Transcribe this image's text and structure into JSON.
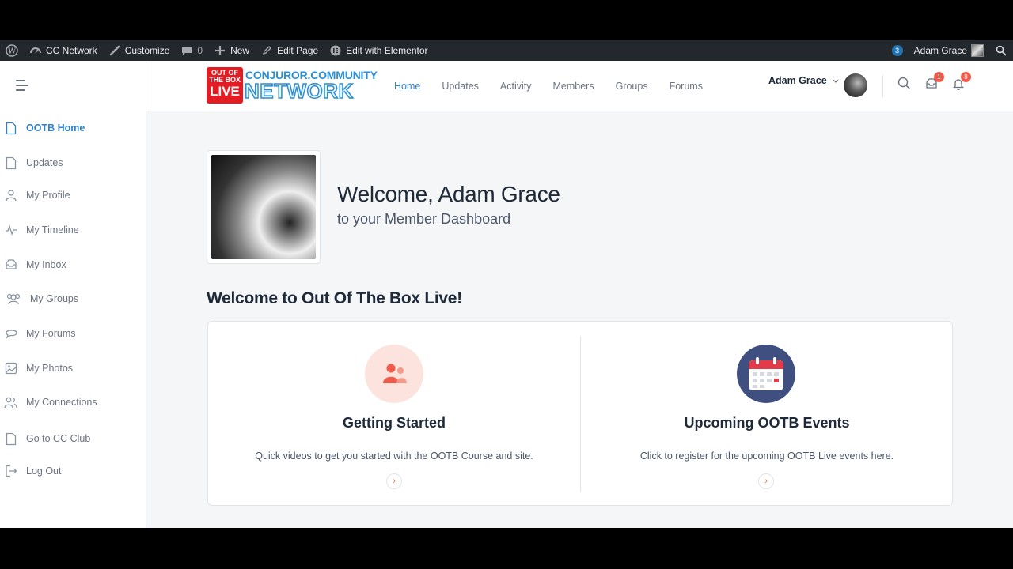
{
  "adminbar": {
    "wp_icon": "wordpress-icon",
    "site": "CC Network",
    "customize": "Customize",
    "comments_count": "0",
    "new": "New",
    "edit_page": "Edit Page",
    "edit_elementor": "Edit with Elementor",
    "notif_count": "3",
    "user": "Adam Grace"
  },
  "sidebar": {
    "items": [
      {
        "label": "OOTB Home",
        "icon": "page-icon"
      },
      {
        "label": "Updates",
        "icon": "page-icon"
      },
      {
        "label": "My Profile",
        "icon": "user-icon"
      },
      {
        "label": "My Timeline",
        "icon": "activity-icon"
      },
      {
        "label": "My Inbox",
        "icon": "inbox-icon"
      },
      {
        "label": "My Groups",
        "icon": "groups-icon"
      },
      {
        "label": "My Forums",
        "icon": "forums-icon"
      },
      {
        "label": "My Photos",
        "icon": "photos-icon"
      },
      {
        "label": "My Connections",
        "icon": "connections-icon"
      },
      {
        "label": "Go to CC Club",
        "icon": "page-icon"
      },
      {
        "label": "Log Out",
        "icon": "logout-icon"
      }
    ]
  },
  "header": {
    "logo": {
      "box_line1": "OUT OF",
      "box_line2": "THE BOX",
      "box_line3": "LIVE",
      "top": "CONJUROR.COMMUNITY",
      "bottom": "NETWORK"
    },
    "nav": [
      "Home",
      "Updates",
      "Activity",
      "Members",
      "Groups",
      "Forums"
    ],
    "user_name": "Adam Grace",
    "messages_badge": "1",
    "notifications_badge": "8"
  },
  "main": {
    "welcome": "Welcome, Adam Grace",
    "welcome_sub": "to your Member Dashboard",
    "section_title": "Welcome to Out Of The Box Live!",
    "cards": [
      {
        "title": "Getting Started",
        "desc": "Quick videos to get you started with the OOTB Course and site.",
        "icon": "users-icon"
      },
      {
        "title": "Upcoming OOTB Events",
        "desc": "Click to register for the upcoming OOTB Live events here.",
        "icon": "calendar-icon"
      }
    ]
  },
  "colors": {
    "accent": "#3182ce",
    "badge": "#ef5b4b",
    "adminbar": "#23282d"
  }
}
